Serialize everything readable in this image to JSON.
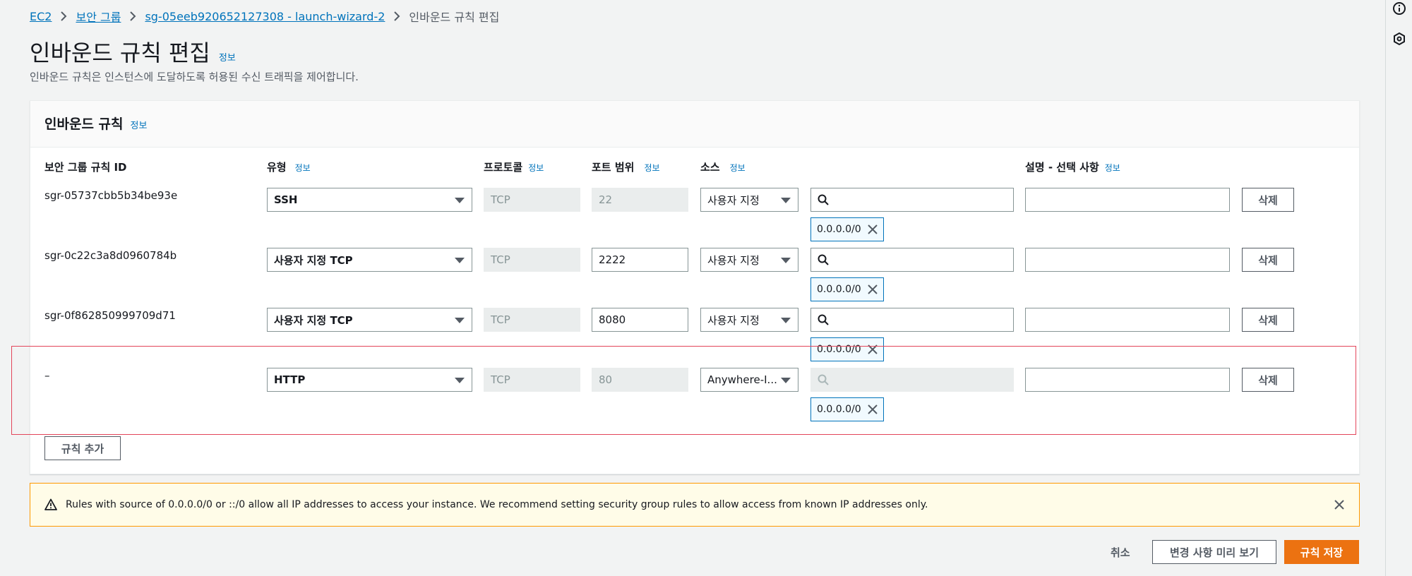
{
  "breadcrumb": {
    "items": [
      "EC2",
      "보안 그룹",
      "sg-05eeb920652127308 - launch-wizard-2"
    ],
    "current": "인바운드 규칙 편집"
  },
  "page": {
    "title": "인바운드 규칙 편집",
    "info": "정보",
    "description": "인바운드 규칙은 인스턴스에 도달하도록 허용된 수신 트래픽을 제어합니다."
  },
  "panel": {
    "title": "인바운드 규칙",
    "info": "정보",
    "columns": {
      "rule_id": "보안 그룹 규칙 ID",
      "type": "유형",
      "protocol": "프로토콜",
      "port_range": "포트 범위",
      "source": "소스",
      "description": "설명 - 선택 사항",
      "info": "정보"
    },
    "rules": [
      {
        "id": "sgr-05737cbb5b34be93e",
        "type": "SSH",
        "protocol": "TCP",
        "port": "22",
        "source": "사용자 지정",
        "search_value": "",
        "cidr": "0.0.0.0/0",
        "description": "",
        "delete": "삭제"
      },
      {
        "id": "sgr-0c22c3a8d0960784b",
        "type": "사용자 지정 TCP",
        "protocol": "TCP",
        "port": "2222",
        "source": "사용자 지정",
        "search_value": "",
        "cidr": "0.0.0.0/0",
        "description": "",
        "delete": "삭제"
      },
      {
        "id": "sgr-0f862850999709d71",
        "type": "사용자 지정 TCP",
        "protocol": "TCP",
        "port": "8080",
        "source": "사용자 지정",
        "search_value": "",
        "cidr": "0.0.0.0/0",
        "description": "",
        "delete": "삭제"
      },
      {
        "id": "–",
        "type": "HTTP",
        "protocol": "TCP",
        "port": "80",
        "source": "Anywhere-I...",
        "search_value": "",
        "cidr": "0.0.0.0/0",
        "description": "",
        "delete": "삭제"
      }
    ],
    "add_rule": "규칙 추가"
  },
  "alert": {
    "text": "Rules with source of 0.0.0.0/0 or ::/0 allow all IP addresses to access your instance. We recommend setting security group rules to allow access from known IP addresses only."
  },
  "footer": {
    "cancel": "취소",
    "preview": "변경 사항 미리 보기",
    "save": "규칙 저장"
  },
  "colors": {
    "accent": "#0073bb",
    "primary": "#ec7211",
    "alert_border": "#ff9900",
    "highlight": "#e3455a"
  }
}
